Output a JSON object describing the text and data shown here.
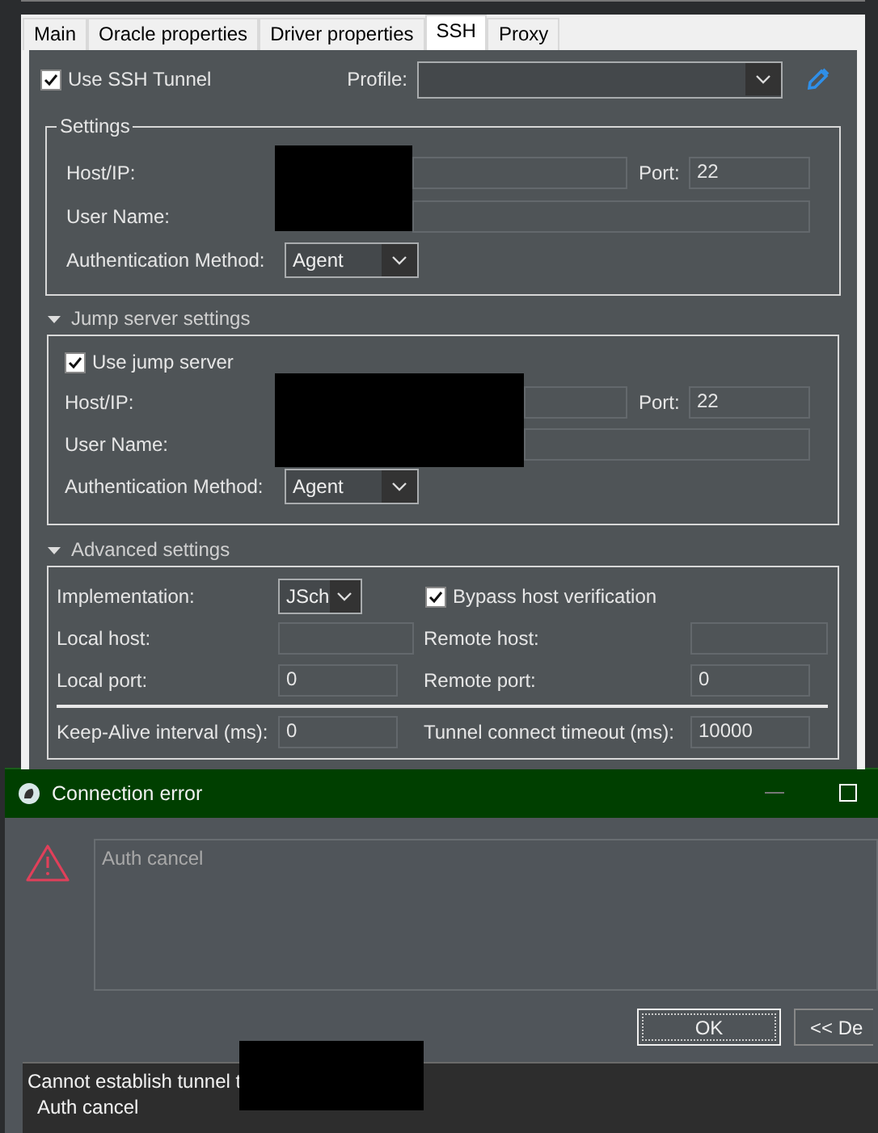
{
  "tabs": [
    {
      "label": "Main",
      "selected": false
    },
    {
      "label": "Oracle properties",
      "selected": false
    },
    {
      "label": "Driver properties",
      "selected": false
    },
    {
      "label": "SSH",
      "selected": true
    },
    {
      "label": "Proxy",
      "selected": false
    }
  ],
  "use_ssh_tunnel": {
    "label": "Use SSH Tunnel",
    "checked": true
  },
  "profile": {
    "label": "Profile:"
  },
  "settings": {
    "title": "Settings",
    "host_label": "Host/IP:",
    "port_label": "Port:",
    "port": "22",
    "user_label": "User Name:",
    "auth_label": "Authentication Method:",
    "auth": "Agent"
  },
  "jump_server": {
    "title": "Jump server settings",
    "expanded": true,
    "use_jump": {
      "label": "Use jump server",
      "checked": true
    },
    "host_label": "Host/IP:",
    "port_label": "Port:",
    "port": "22",
    "user_label": "User Name:",
    "auth_label": "Authentication Method:",
    "auth": "Agent"
  },
  "advanced": {
    "title": "Advanced settings",
    "expanded": true,
    "implementation_label": "Implementation:",
    "implementation": "JSch",
    "bypass": {
      "label": "Bypass host verification",
      "checked": true
    },
    "local_host_label": "Local host:",
    "remote_host_label": "Remote host:",
    "local_port_label": "Local port:",
    "local_port": "0",
    "remote_port_label": "Remote port:",
    "remote_port": "0",
    "keepalive_label": "Keep-Alive interval (ms):",
    "keepalive": "0",
    "timeout_label": "Tunnel connect timeout (ms):",
    "timeout": "10000"
  },
  "dialog": {
    "title": "Connection error",
    "message": "Auth cancel",
    "ok": "OK",
    "details_button": "<< De",
    "details": [
      "Cannot establish tunnel t",
      "Auth cancel"
    ]
  }
}
